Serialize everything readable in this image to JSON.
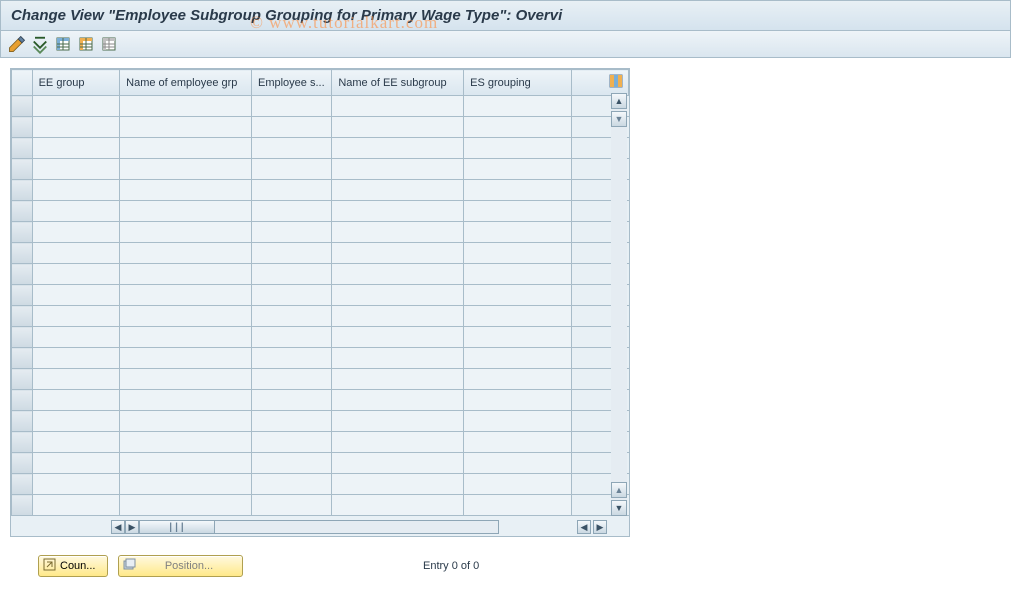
{
  "title": "Change View \"Employee Subgroup Grouping for Primary Wage Type\": Overvi",
  "watermark": "© www.tutorialkart.com",
  "columns": {
    "ee_group": "EE group",
    "name_emp_grp": "Name of employee grp",
    "emp_sub": "Employee s...",
    "name_ee_sub": "Name of EE subgroup",
    "es_grouping": "ES grouping"
  },
  "footer": {
    "coun_label": "Coun...",
    "position_label": "Position...",
    "entry_status": "Entry 0 of 0"
  },
  "row_count": 20
}
